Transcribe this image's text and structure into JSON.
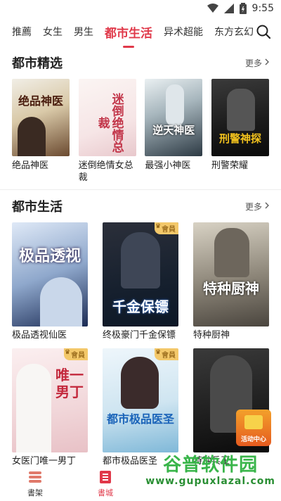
{
  "status": {
    "time": "9:55"
  },
  "tabs": [
    {
      "label": "推薦"
    },
    {
      "label": "女生"
    },
    {
      "label": "男生"
    },
    {
      "label": "都市生活"
    },
    {
      "label": "异术超能"
    },
    {
      "label": "东方玄幻"
    }
  ],
  "section1": {
    "title": "都市精选",
    "more": "更多",
    "books": [
      {
        "title": "绝品神医",
        "cover_text": "绝品神医"
      },
      {
        "title": "迷倒绝情女总裁",
        "cover_text": "迷倒绝情总裁"
      },
      {
        "title": "最强小神医",
        "cover_text": "逆天神医"
      },
      {
        "title": "刑警荣耀",
        "cover_text": "刑警神探"
      }
    ]
  },
  "section2": {
    "title": "都市生活",
    "more": "更多",
    "vip_label": "會員",
    "books": [
      {
        "title": "极品透视仙医",
        "cover_text": "极品透视",
        "vip": false
      },
      {
        "title": "终极豪门千金保镖",
        "cover_text": "千金保镖",
        "vip": true
      },
      {
        "title": "特种厨神",
        "cover_text": "特种厨神",
        "vip": false
      },
      {
        "title": "女医门唯一男丁",
        "cover_text": "唯一男丁",
        "vip": true
      },
      {
        "title": "都市极品医圣",
        "cover_text": "都市极品医圣",
        "vip": true
      },
      {
        "title": "特种兵王",
        "cover_text": "",
        "vip": false
      }
    ]
  },
  "floating": {
    "label": "活动中心"
  },
  "bottom_nav": [
    {
      "label": "書架"
    },
    {
      "label": "書城"
    }
  ],
  "watermark": {
    "main": "谷普软件园",
    "url": "www.gupuxlazal.com"
  },
  "colors": {
    "accent": "#e0394a",
    "watermark": "#39b54a"
  }
}
